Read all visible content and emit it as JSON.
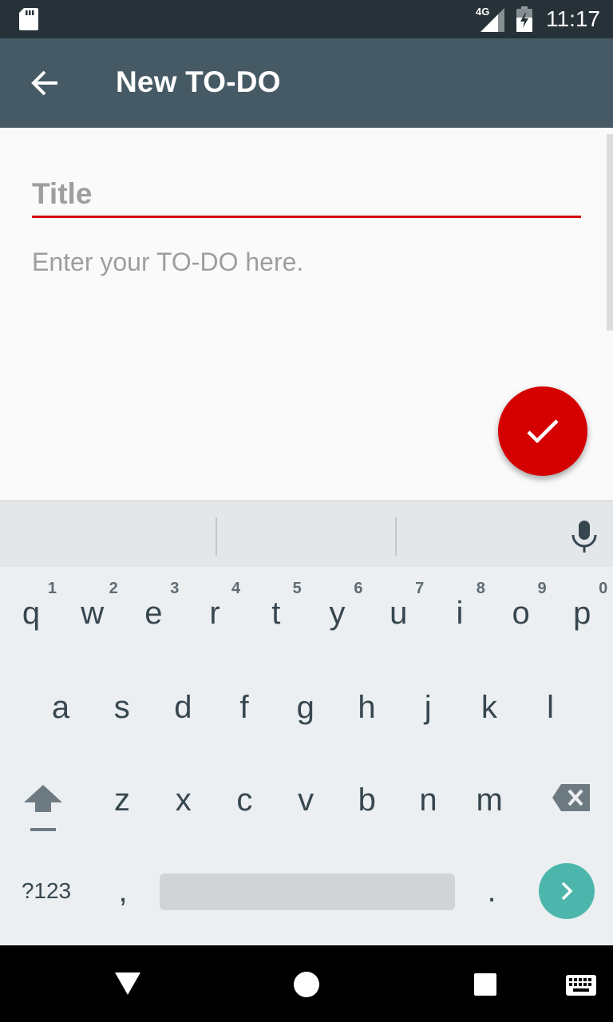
{
  "status_bar": {
    "time": "11:17",
    "network_label": "4G",
    "icons": [
      "sd-card-icon",
      "signal-4g-icon",
      "battery-charging-icon"
    ]
  },
  "app_bar": {
    "title": "New TO-DO",
    "back_icon": "arrow-back-icon"
  },
  "form": {
    "title_placeholder": "Title",
    "body_placeholder": "Enter your TO-DO here.",
    "accent_color": "#d50000"
  },
  "fab": {
    "icon": "check-icon",
    "color": "#d50000"
  },
  "keyboard": {
    "row1": [
      {
        "k": "q",
        "h": "1"
      },
      {
        "k": "w",
        "h": "2"
      },
      {
        "k": "e",
        "h": "3"
      },
      {
        "k": "r",
        "h": "4"
      },
      {
        "k": "t",
        "h": "5"
      },
      {
        "k": "y",
        "h": "6"
      },
      {
        "k": "u",
        "h": "7"
      },
      {
        "k": "i",
        "h": "8"
      },
      {
        "k": "o",
        "h": "9"
      },
      {
        "k": "p",
        "h": "0"
      }
    ],
    "row2": [
      "a",
      "s",
      "d",
      "f",
      "g",
      "h",
      "j",
      "k",
      "l"
    ],
    "row3": [
      "z",
      "x",
      "c",
      "v",
      "b",
      "n",
      "m"
    ],
    "symbols_label": "?123",
    "comma": ",",
    "period": ".",
    "enter_icon": "chevron-right-icon",
    "enter_color": "#4db6ac"
  },
  "nav_bar": {
    "icons": [
      "back-triangle-icon",
      "home-circle-icon",
      "recents-square-icon",
      "keyboard-switch-icon"
    ]
  }
}
